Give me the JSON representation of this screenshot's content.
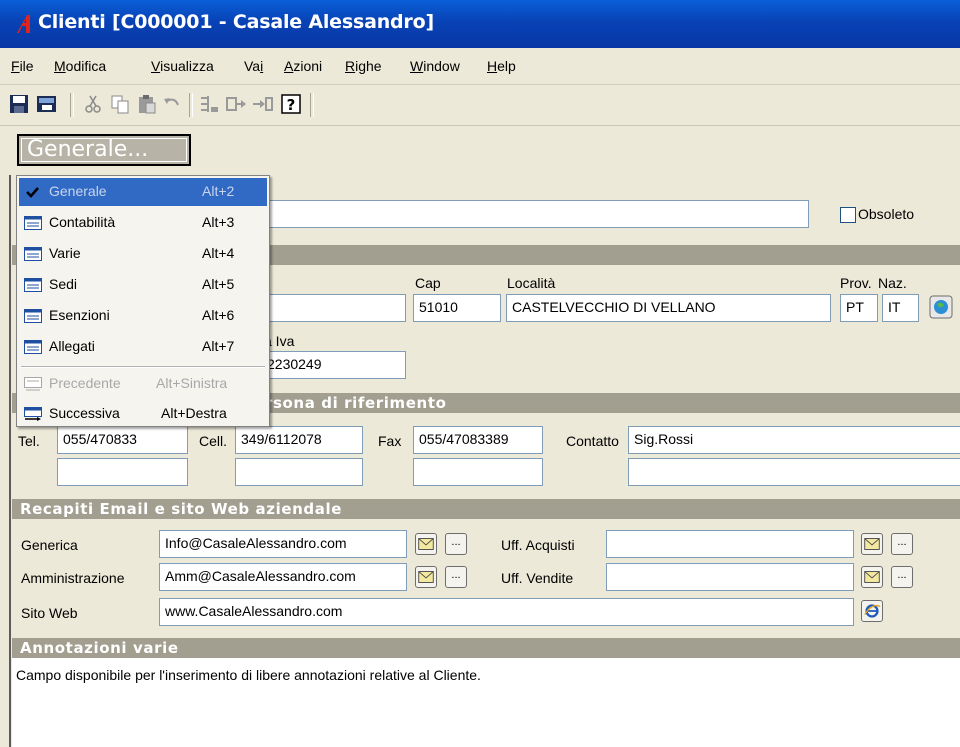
{
  "window": {
    "title": "Clienti [C000001 - Casale Alessandro]"
  },
  "menubar": [
    {
      "label": "File",
      "u": "F",
      "rest": "ile"
    },
    {
      "label": "Modifica",
      "u": "M",
      "rest": "odifica"
    },
    {
      "label": "Visualizza",
      "u": "V",
      "rest": "isualizza"
    },
    {
      "label": "Vai",
      "u": "",
      "pre": "Va",
      "u2": "i"
    },
    {
      "label": "Azioni",
      "u": "A",
      "rest": "zioni"
    },
    {
      "label": "Righe",
      "u": "R",
      "rest": "ighe"
    },
    {
      "label": "Window",
      "u": "W",
      "rest": "indow"
    },
    {
      "label": "Help",
      "u": "H",
      "rest": "elp"
    }
  ],
  "tab_button": {
    "label": "Generale..."
  },
  "popup_menu": {
    "items": [
      {
        "label": "Generale",
        "shortcut": "Alt+2",
        "checked": true,
        "selected": true
      },
      {
        "label": "Contabilità",
        "shortcut": "Alt+3"
      },
      {
        "label": "Varie",
        "shortcut": "Alt+4"
      },
      {
        "label": "Sedi",
        "shortcut": "Alt+5"
      },
      {
        "label": "Esenzioni",
        "shortcut": "Alt+6"
      },
      {
        "label": "Allegati",
        "shortcut": "Alt+7"
      }
    ],
    "nav": [
      {
        "label": "Precedente",
        "shortcut": "Alt+Sinistra",
        "disabled": true
      },
      {
        "label": "Successiva",
        "shortcut": "Alt+Destra"
      }
    ]
  },
  "obsoleto": {
    "label": "Obsoleto",
    "checked": false
  },
  "address": {
    "cap_label": "Cap",
    "cap": "51010",
    "localita_label": "Località",
    "localita": "CASTELVECCHIO DI VELLANO",
    "prov_label": "Prov.",
    "prov": "PT",
    "naz_label": "Naz.",
    "naz": "IT",
    "piva_label_partial": "a Iva",
    "piva_partial": "2230249"
  },
  "contacts": {
    "section_partial": "rsona di riferimento",
    "tel_label": "Tel.",
    "tel": "055/470833",
    "cell_label": "Cell.",
    "cell": "349/6112078",
    "fax_label": "Fax",
    "fax": "055/47083389",
    "contatto_label": "Contatto",
    "contatto": "Sig.Rossi"
  },
  "email": {
    "section": "Recapiti Email e sito Web aziendale",
    "generica_label": "Generica",
    "generica": "Info@CasaleAlessandro.com",
    "amm_label": "Amministrazione",
    "amm": "Amm@CasaleAlessandro.com",
    "acq_label": "Uff. Acquisti",
    "acq": "",
    "vend_label": "Uff. Vendite",
    "vend": "",
    "web_label": "Sito Web",
    "web": "www.CasaleAlessandro.com",
    "dots": "..."
  },
  "notes": {
    "section": "Annotazioni varie",
    "text": "Campo disponibile per l'inserimento di libere annotazioni relative al Cliente."
  }
}
